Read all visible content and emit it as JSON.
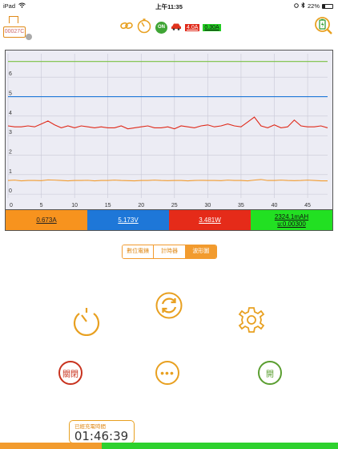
{
  "status_bar": {
    "device": "iPad",
    "time": "上午11:35",
    "battery": "22%"
  },
  "toolbar": {
    "device_label": "00027C",
    "power_label": "ON",
    "current_limit": "4.0A",
    "current_reading": "0.30A",
    "icons": [
      "link-icon",
      "timer-icon",
      "car-icon",
      "battery-charge-icon"
    ]
  },
  "chart_data": {
    "type": "line",
    "x": [
      0,
      1,
      2,
      3,
      4,
      5,
      6,
      7,
      8,
      9,
      10,
      11,
      12,
      13,
      14,
      15,
      16,
      17,
      18,
      19,
      20,
      21,
      22,
      23,
      24,
      25,
      26,
      27,
      28,
      29,
      30,
      31,
      32,
      33,
      34,
      35,
      36,
      37,
      38,
      39,
      40,
      41,
      42,
      43,
      44,
      45,
      46,
      47,
      48
    ],
    "xticks": [
      0,
      5,
      10,
      15,
      20,
      25,
      30,
      35,
      40,
      45
    ],
    "yticks": [
      0,
      1,
      2,
      3,
      4,
      5,
      6
    ],
    "xlim": [
      0,
      48
    ],
    "ylim": [
      -0.2,
      7.2
    ],
    "grid": true,
    "series": [
      {
        "color": "#7ac143",
        "values": [
          6.8,
          6.8,
          6.8,
          6.8,
          6.8,
          6.8,
          6.8,
          6.8,
          6.8,
          6.8,
          6.8,
          6.8,
          6.8,
          6.8,
          6.8,
          6.8,
          6.8,
          6.8,
          6.8,
          6.8,
          6.8,
          6.8,
          6.8,
          6.8,
          6.8,
          6.8,
          6.8,
          6.8,
          6.8,
          6.8,
          6.8,
          6.8,
          6.8,
          6.8,
          6.8,
          6.8,
          6.8,
          6.8,
          6.8,
          6.8,
          6.8,
          6.8,
          6.8,
          6.8,
          6.8,
          6.8,
          6.8,
          6.8,
          6.8
        ]
      },
      {
        "color": "#1e77d8",
        "values": [
          5.0,
          5.0,
          5.0,
          5.0,
          5.0,
          5.0,
          5.0,
          5.0,
          5.0,
          5.0,
          5.0,
          5.0,
          5.0,
          5.0,
          5.0,
          5.0,
          5.0,
          5.0,
          5.0,
          5.0,
          5.0,
          5.0,
          5.0,
          5.0,
          5.0,
          5.0,
          5.0,
          5.0,
          5.0,
          5.0,
          5.0,
          5.0,
          5.0,
          5.0,
          5.0,
          5.0,
          5.0,
          5.0,
          5.0,
          5.0,
          5.0,
          5.0,
          5.0,
          5.0,
          5.0,
          5.0,
          5.0,
          5.0,
          5.0
        ]
      },
      {
        "color": "#e02a1a",
        "values": [
          3.5,
          3.45,
          3.45,
          3.5,
          3.45,
          3.6,
          3.75,
          3.55,
          3.4,
          3.5,
          3.4,
          3.5,
          3.45,
          3.4,
          3.45,
          3.4,
          3.4,
          3.5,
          3.35,
          3.4,
          3.45,
          3.5,
          3.4,
          3.4,
          3.45,
          3.35,
          3.5,
          3.45,
          3.4,
          3.5,
          3.55,
          3.45,
          3.5,
          3.6,
          3.5,
          3.45,
          3.7,
          3.95,
          3.5,
          3.4,
          3.55,
          3.4,
          3.45,
          3.8,
          3.5,
          3.45,
          3.45,
          3.5,
          3.4
        ]
      },
      {
        "color": "#f29b2e",
        "values": [
          0.7,
          0.72,
          0.68,
          0.7,
          0.7,
          0.69,
          0.73,
          0.72,
          0.7,
          0.68,
          0.7,
          0.7,
          0.71,
          0.68,
          0.7,
          0.7,
          0.72,
          0.7,
          0.69,
          0.68,
          0.7,
          0.7,
          0.72,
          0.7,
          0.69,
          0.7,
          0.7,
          0.68,
          0.7,
          0.71,
          0.7,
          0.7,
          0.69,
          0.72,
          0.7,
          0.7,
          0.68,
          0.72,
          0.75,
          0.7,
          0.7,
          0.72,
          0.7,
          0.69,
          0.7,
          0.72,
          0.7,
          0.68,
          0.68
        ]
      }
    ]
  },
  "readouts": {
    "current": "0.673A",
    "voltage": "5.173V",
    "power": "3.481W",
    "capacity": "2324.1mAH",
    "capacity_sub": "u:0.00300"
  },
  "tabs": {
    "labels": [
      "數位電錶",
      "計時器",
      "波形圖"
    ],
    "active": "波形圖"
  },
  "controls": {
    "close_label": "關閉",
    "more_label": "•••",
    "open_label": "開",
    "icons": [
      "stopwatch-icon",
      "refresh-icon",
      "gear-icon"
    ]
  },
  "timer": {
    "caption": "已經充電時間",
    "elapsed": "01:46:39"
  },
  "progress": {
    "fraction": 0.3
  },
  "colors": {
    "accent": "#f29b2e",
    "red": "#e02a1a",
    "green": "#22e022",
    "blue": "#1e77d8"
  }
}
